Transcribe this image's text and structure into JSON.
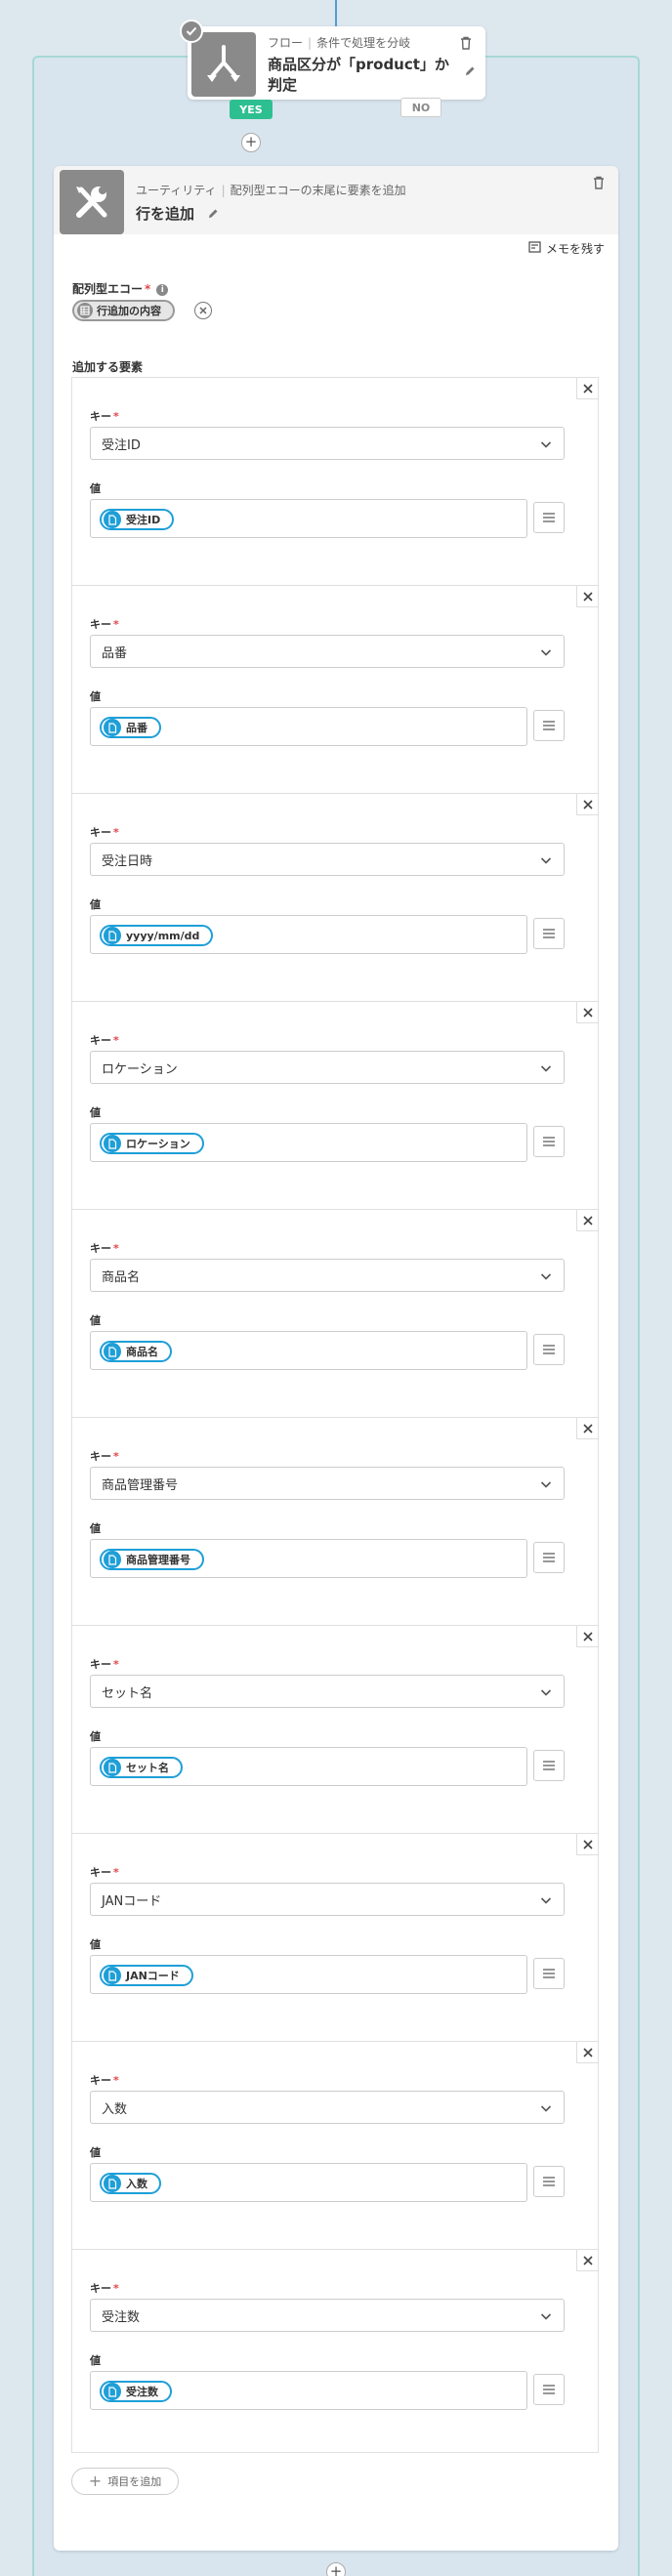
{
  "flow_node": {
    "category": "フロー",
    "subtitle": "条件で処理を分岐",
    "title": "商品区分が「product」か判定",
    "yes_label": "YES",
    "no_label": "NO"
  },
  "action_node": {
    "category": "ユーティリティ",
    "subtitle": "配列型エコーの末尾に要素を追加",
    "title": "行を追加",
    "memo_label": "メモを残す",
    "array_field_label": "配列型エコー",
    "array_chip_label": "行追加の内容",
    "elements_label": "追加する要素",
    "key_label": "キー",
    "value_label": "値",
    "required_mark": "*",
    "add_item_label": "項目を追加",
    "elements": [
      {
        "key": "受注ID",
        "value": "受注ID"
      },
      {
        "key": "品番",
        "value": "品番"
      },
      {
        "key": "受注日時",
        "value": "yyyy/mm/dd"
      },
      {
        "key": "ロケーション",
        "value": "ロケーション"
      },
      {
        "key": "商品名",
        "value": "商品名"
      },
      {
        "key": "商品管理番号",
        "value": "商品管理番号"
      },
      {
        "key": "セット名",
        "value": "セット名"
      },
      {
        "key": "JANコード",
        "value": "JANコード"
      },
      {
        "key": "入数",
        "value": "入数"
      },
      {
        "key": "受注数",
        "value": "受注数"
      }
    ]
  },
  "colors": {
    "accent": "#1e9fd8",
    "yes": "#2ebf91",
    "required": "#e0464b",
    "connector": "#4b9fd5",
    "frame": "#a8d8d6"
  }
}
